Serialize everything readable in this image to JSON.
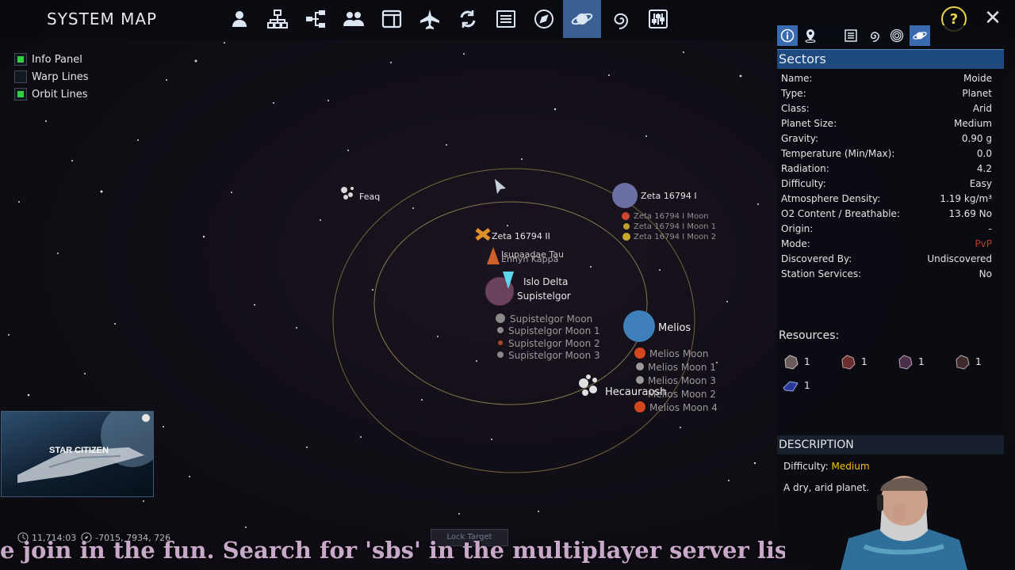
{
  "header": {
    "title": "SYSTEM MAP",
    "toolbar": [
      {
        "icon": "person-icon"
      },
      {
        "icon": "network-icon"
      },
      {
        "icon": "hierarchy-icon"
      },
      {
        "icon": "group-icon"
      },
      {
        "icon": "window-icon"
      },
      {
        "icon": "jet-icon"
      },
      {
        "icon": "refresh-icon"
      },
      {
        "icon": "list-icon"
      },
      {
        "icon": "compass-icon"
      },
      {
        "icon": "planet-icon",
        "active": true
      },
      {
        "icon": "galaxy-icon"
      },
      {
        "icon": "sliders-icon"
      }
    ],
    "help_label": "?",
    "close_label": "✕"
  },
  "toggles": [
    {
      "label": "Info Panel",
      "checked": true
    },
    {
      "label": "Warp Lines",
      "checked": false
    },
    {
      "label": "Orbit Lines",
      "checked": true
    }
  ],
  "map": {
    "labels": {
      "feaq": "Feaq",
      "zeta1": "Zeta 16794 I",
      "zeta1_moon": "Zeta 16794 I Moon",
      "zeta1_moon1": "Zeta 16794 I Moon 1",
      "zeta1_moon2": "Zeta 16794 I Moon 2",
      "zeta2": "Zeta 16794 II",
      "isupaadae": "Isupaadae Tau",
      "enhyn": "Enhyn Kappa",
      "islo": "Islo Delta",
      "supistelgor": "Supistelgor",
      "sup_moon": "Supistelgor Moon",
      "sup_moon1": "Supistelgor Moon 1",
      "sup_moon2": "Supistelgor Moon 2",
      "sup_moon3": "Supistelgor Moon 3",
      "melios": "Melios",
      "melios_moon": "Melios Moon",
      "melios_moon1": "Melios Moon 1",
      "melios_moon3": "Melios Moon 3",
      "melios_moon2": "Melios Moon 2",
      "melios_moon4": "Melios Moon 4",
      "hecauraosh": "Hecauraosh"
    },
    "coords": {
      "time": "11,714:03",
      "position": "-7015, 7934, 726"
    },
    "lock_button": "Lock Target"
  },
  "panel": {
    "tools": [
      {
        "icon": "info-icon",
        "selected": true
      },
      {
        "icon": "map-pin-icon"
      },
      {
        "icon": "list-view-icon"
      },
      {
        "icon": "spiral-icon"
      },
      {
        "icon": "target-rings-icon"
      },
      {
        "icon": "planet-view-icon",
        "selected": true
      }
    ],
    "section_title": "Sectors",
    "properties": [
      {
        "label": "Name:",
        "value": "Moide"
      },
      {
        "label": "Type:",
        "value": "Planet"
      },
      {
        "label": "Class:",
        "value": "Arid"
      },
      {
        "label": "Planet Size:",
        "value": "Medium"
      },
      {
        "label": "Gravity:",
        "value": "0.90 g"
      },
      {
        "label": "Temperature (Min/Max):",
        "value": "0.0"
      },
      {
        "label": "Radiation:",
        "value": "4.2"
      },
      {
        "label": "Difficulty:",
        "value": "Easy"
      },
      {
        "label": "Atmosphere Density:",
        "value": "1.19 kg/m³"
      },
      {
        "label": "O2 Content / Breathable:",
        "value": "13.69 No"
      },
      {
        "label": "Origin:",
        "value": "-"
      },
      {
        "label": "Mode:",
        "value": "PvP"
      },
      {
        "label": "Discovered By:",
        "value": "Undiscovered"
      },
      {
        "label": "Station Services:",
        "value": "No"
      }
    ],
    "resources_title": "Resources:",
    "resources": [
      {
        "icon": "ore-rock-icon",
        "count": "1"
      },
      {
        "icon": "ore-rock-red-icon",
        "count": "1"
      },
      {
        "icon": "ore-rock-purple-icon",
        "count": "1"
      },
      {
        "icon": "ore-rock-dark-icon",
        "count": "1"
      },
      {
        "icon": "ice-crystal-icon",
        "count": "1"
      }
    ],
    "description_title": "DESCRIPTION",
    "difficulty_label": "Difficulty:",
    "difficulty_value": "Medium",
    "description": "A dry, arid planet."
  },
  "overlay": {
    "logo_icon": "star-citizen-logo",
    "logo_text": "STAR CITIZEN",
    "ticker": "e join in the fun.  Search for 'sbs' in the multiplayer server list in Em"
  },
  "colors": {
    "accent": "#3a5f92",
    "header_bar": "#1e4a80",
    "toggle_on": "#31d043",
    "pvp": "#c0392b",
    "medium": "#f1c40f",
    "orbit": "#8c7a4a"
  }
}
